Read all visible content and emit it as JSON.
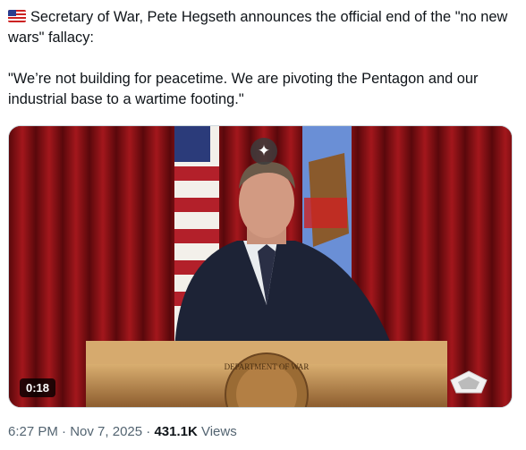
{
  "tweet": {
    "line1": "Secretary of War, Pete Hegseth announces the official end of the \"no new wars\" fallacy:",
    "line2": "\"We’re not building for peacetime. We are pivoting the Pentagon and our industrial base to a wartime footing.\""
  },
  "media": {
    "duration": "0:18",
    "sparkle_glyph": "✦",
    "podium_seal_text": "DEPARTMENT OF WAR"
  },
  "meta": {
    "time": "6:27 PM",
    "sep1": " · ",
    "date": "Nov 7, 2025",
    "sep2": " · ",
    "views_count": "431.1K",
    "views_label": " Views"
  },
  "colors": {
    "curtain": "#8c1014",
    "podium": "#c79a5e",
    "text": "#0f1419",
    "muted": "#536471"
  }
}
